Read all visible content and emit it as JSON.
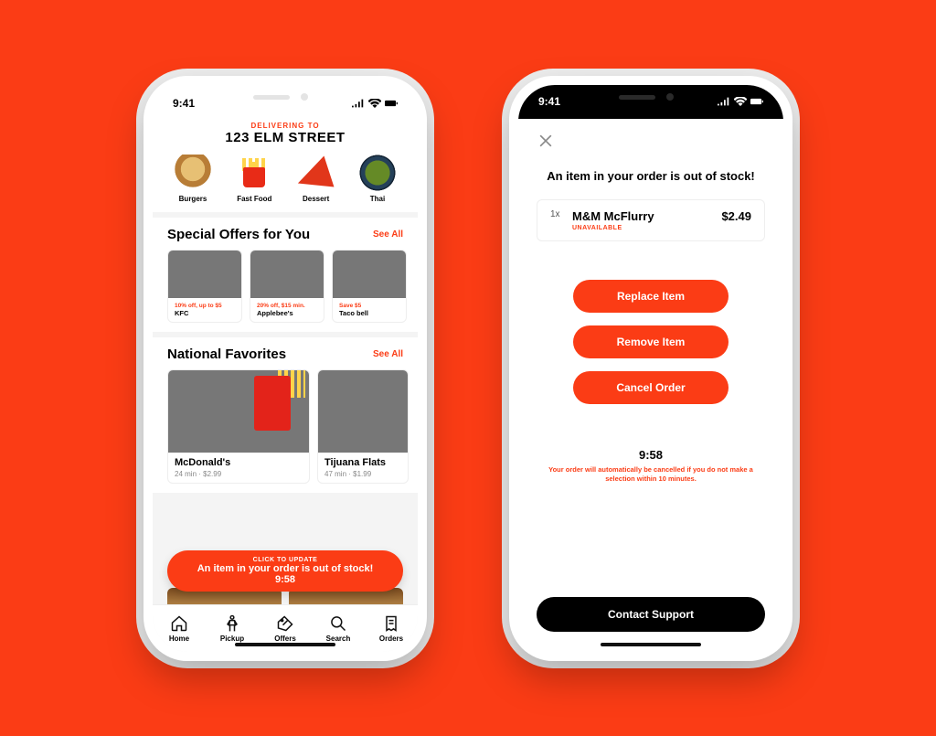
{
  "status": {
    "time": "9:41"
  },
  "home": {
    "delivering_label": "DELIVERING TO",
    "address": "123 ELM STREET",
    "categories": [
      "Burgers",
      "Fast Food",
      "Dessert",
      "Thai"
    ],
    "offers": {
      "title": "Special Offers for You",
      "see_all": "See All",
      "items": [
        {
          "promo": "10% off, up to $5",
          "restaurant": "KFC"
        },
        {
          "promo": "20% off, $15 min.",
          "restaurant": "Applebee's"
        },
        {
          "promo": "Save $5",
          "restaurant": "Taco bell"
        }
      ]
    },
    "favorites": {
      "title": "National Favorites",
      "see_all": "See All",
      "items": [
        {
          "restaurant": "McDonald's",
          "meta": "24 min · $2.99"
        },
        {
          "restaurant": "Tijuana Flats",
          "meta": "47 min · $1.99"
        }
      ]
    },
    "banner": {
      "line1": "CLICK TO UPDATE",
      "line2": "An item in your order is out of stock!",
      "timer": "9:58"
    },
    "tabs": [
      "Home",
      "Pickup",
      "Offers",
      "Search",
      "Orders"
    ]
  },
  "modal": {
    "title": "An item in your order is out of stock!",
    "item": {
      "qty": "1x",
      "name": "M&M McFlurry",
      "status": "UNAVAILABLE",
      "price": "$2.49"
    },
    "actions": {
      "replace": "Replace Item",
      "remove": "Remove Item",
      "cancel": "Cancel Order"
    },
    "timer": "9:58",
    "warning": "Your order will automatically be cancelled if you do not make a selection within 10 minutes.",
    "support": "Contact Support"
  }
}
